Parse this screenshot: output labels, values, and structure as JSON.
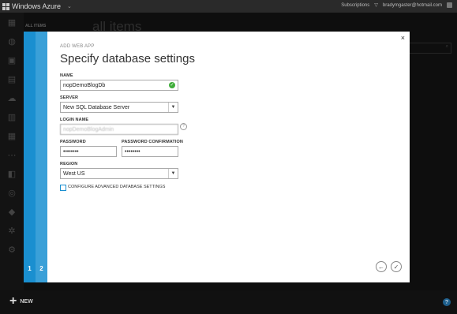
{
  "app": {
    "title": "Windows Azure"
  },
  "topbar": {
    "subscriptions_label": "Subscriptions",
    "user_email": "bradymgaster@hotmail.com"
  },
  "background": {
    "all_items_label": "ALL ITEMS",
    "page_title": "all items"
  },
  "bottombar": {
    "new_label": "NEW",
    "help_label": "?"
  },
  "wizard": {
    "subtitle": "ADD WEB APP",
    "title": "Specify database settings",
    "steps": [
      "1",
      "2"
    ],
    "fields": {
      "name": {
        "label": "NAME",
        "value": "nopDemoBlogDb"
      },
      "server": {
        "label": "SERVER",
        "value": "New SQL Database Server"
      },
      "login": {
        "label": "LOGIN NAME",
        "value": "nopDemoBlogAdmin"
      },
      "password": {
        "label": "PASSWORD",
        "value": "••••••••"
      },
      "password_confirm": {
        "label": "PASSWORD CONFIRMATION",
        "value": "••••••••"
      },
      "region": {
        "label": "REGION",
        "value": "West US"
      }
    },
    "advanced_label": "CONFIGURE ADVANCED DATABASE SETTINGS",
    "close_label": "×"
  },
  "colors": {
    "accent": "#1a8fd0",
    "valid": "#3fad3a"
  }
}
